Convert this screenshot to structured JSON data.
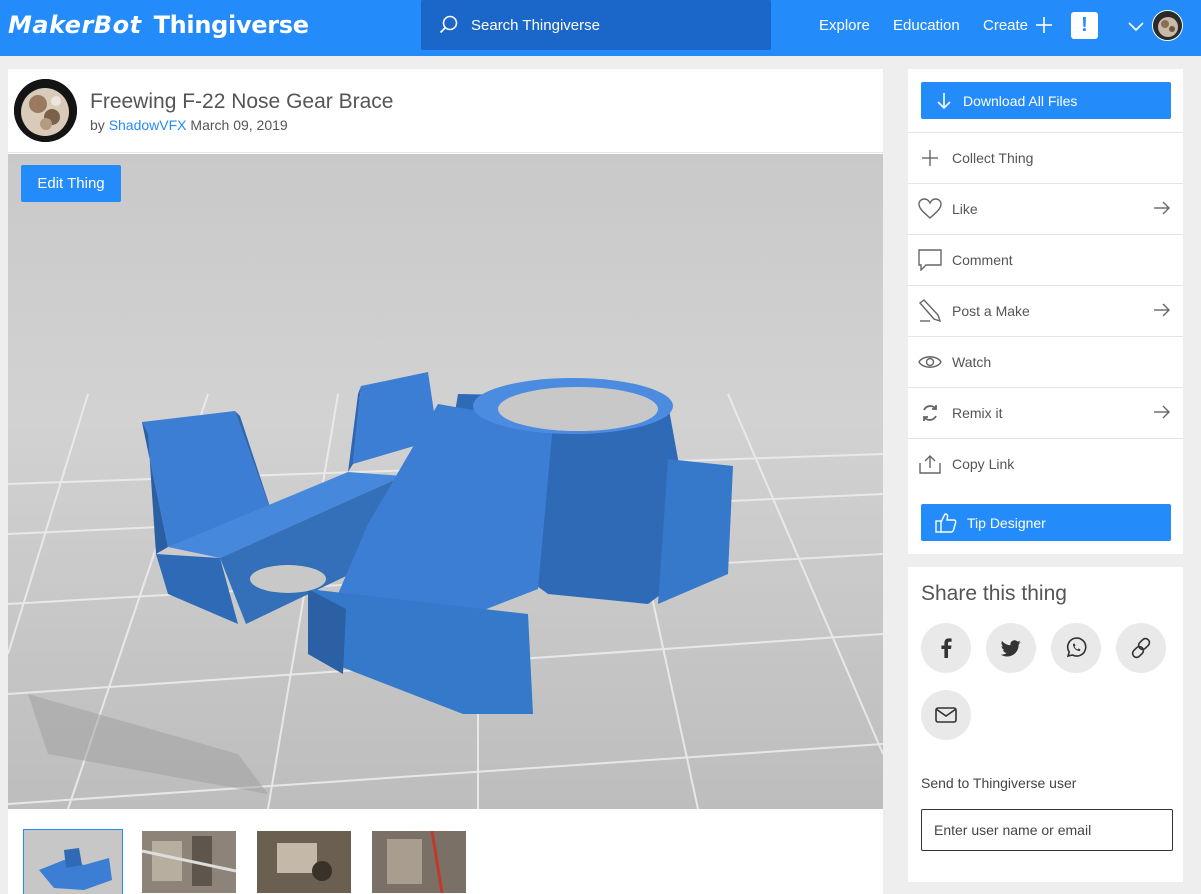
{
  "header": {
    "logo_makerbot": "MakerBot",
    "logo_thingiverse": "Thingiverse",
    "search_placeholder": "Search Thingiverse",
    "nav": [
      "Explore",
      "Education",
      "Create"
    ],
    "alert_label": "!",
    "brand_color": "#248bfb"
  },
  "thing": {
    "title": "Freewing F-22 Nose Gear Brace",
    "by": "by",
    "author": "ShadowVFX",
    "date": "March 09, 2019",
    "edit_label": "Edit Thing",
    "model_color": "#3d7fd6"
  },
  "sidebar": {
    "download_label": "Download All Files",
    "actions": [
      {
        "label": "Collect Thing",
        "icon": "plus-icon",
        "arrow": false
      },
      {
        "label": "Like",
        "icon": "heart-icon",
        "arrow": true
      },
      {
        "label": "Comment",
        "icon": "comment-icon",
        "arrow": false
      },
      {
        "label": "Post a Make",
        "icon": "pencil-icon",
        "arrow": true
      },
      {
        "label": "Watch",
        "icon": "eye-icon",
        "arrow": false
      },
      {
        "label": "Remix it",
        "icon": "remix-icon",
        "arrow": true
      },
      {
        "label": "Copy Link",
        "icon": "share-icon",
        "arrow": false
      }
    ],
    "tip_label": "Tip Designer"
  },
  "share": {
    "title": "Share this thing",
    "networks": [
      "facebook-icon",
      "twitter-icon",
      "whatsapp-icon",
      "link-icon",
      "email-icon"
    ],
    "send_label": "Send to Thingiverse user",
    "send_placeholder": "Enter user name or email"
  }
}
